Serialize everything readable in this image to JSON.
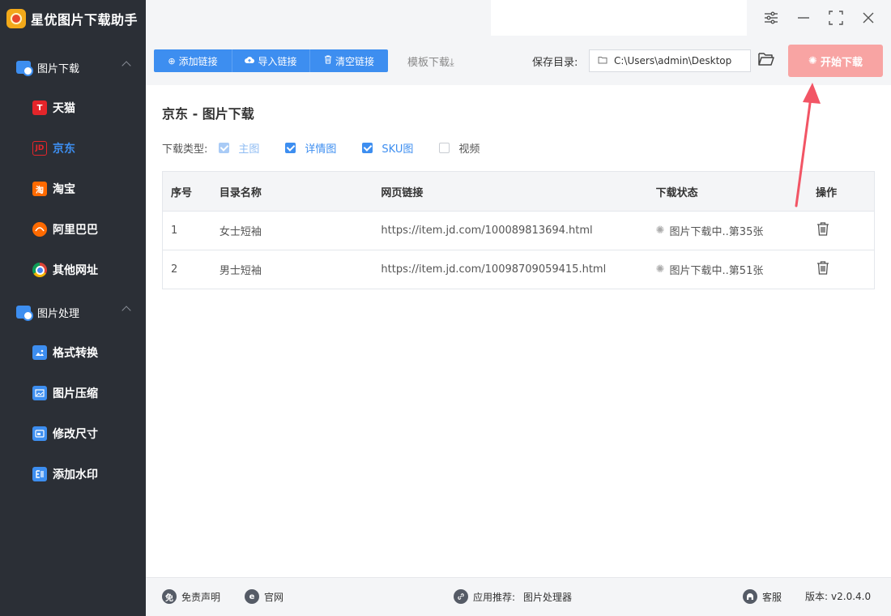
{
  "app": {
    "title": "星优图片下载助手"
  },
  "sidebar": {
    "groups": [
      {
        "label": "图片下载",
        "items": [
          {
            "label": "天猫",
            "icon": "tmall-icon",
            "glyph": "T"
          },
          {
            "label": "京东",
            "icon": "jd-icon",
            "glyph": "JD",
            "active": true
          },
          {
            "label": "淘宝",
            "icon": "taobao-icon",
            "glyph": "淘"
          },
          {
            "label": "阿里巴巴",
            "icon": "alibaba-icon",
            "glyph": ""
          },
          {
            "label": "其他网址",
            "icon": "chrome-icon",
            "glyph": ""
          }
        ]
      },
      {
        "label": "图片处理",
        "items": [
          {
            "label": "格式转换",
            "icon": "image-convert-icon"
          },
          {
            "label": "图片压缩",
            "icon": "image-compress-icon"
          },
          {
            "label": "修改尺寸",
            "icon": "resize-icon"
          },
          {
            "label": "添加水印",
            "icon": "watermark-icon"
          }
        ]
      }
    ]
  },
  "toolbar": {
    "add_link": "添加链接",
    "import_link": "导入链接",
    "clear_link": "清空链接",
    "template_download": "模板下载",
    "save_dir_label": "保存目录:",
    "save_dir_value": "C:\\Users\\admin\\Desktop",
    "start_download": "开始下载"
  },
  "main": {
    "title": "京东 - 图片下载",
    "download_type_label": "下载类型:",
    "types": [
      {
        "label": "主图",
        "checked": true,
        "disabled": true
      },
      {
        "label": "详情图",
        "checked": true,
        "disabled": false
      },
      {
        "label": "SKU图",
        "checked": true,
        "disabled": false
      },
      {
        "label": "视频",
        "checked": false,
        "disabled": false
      }
    ]
  },
  "table": {
    "headers": [
      "序号",
      "目录名称",
      "网页链接",
      "下载状态",
      "操作"
    ],
    "rows": [
      {
        "index": "1",
        "name": "女士短袖",
        "url": "https://item.jd.com/100089813694.html",
        "status": "图片下载中..第35张"
      },
      {
        "index": "2",
        "name": "男士短袖",
        "url": "https://item.jd.com/10098709059415.html",
        "status": "图片下载中..第51张"
      }
    ]
  },
  "footer": {
    "disclaimer": "免责声明",
    "website": "官网",
    "recommend_label": "应用推荐:",
    "recommend_value": "图片处理器",
    "service": "客服",
    "version_label": "版本:",
    "version_value": "v2.0.4.0"
  },
  "colors": {
    "sidebar_bg": "#2b2f36",
    "accent": "#3d8ef0",
    "start_button": "#f8a4a3",
    "annotation_arrow": "#f25565"
  }
}
